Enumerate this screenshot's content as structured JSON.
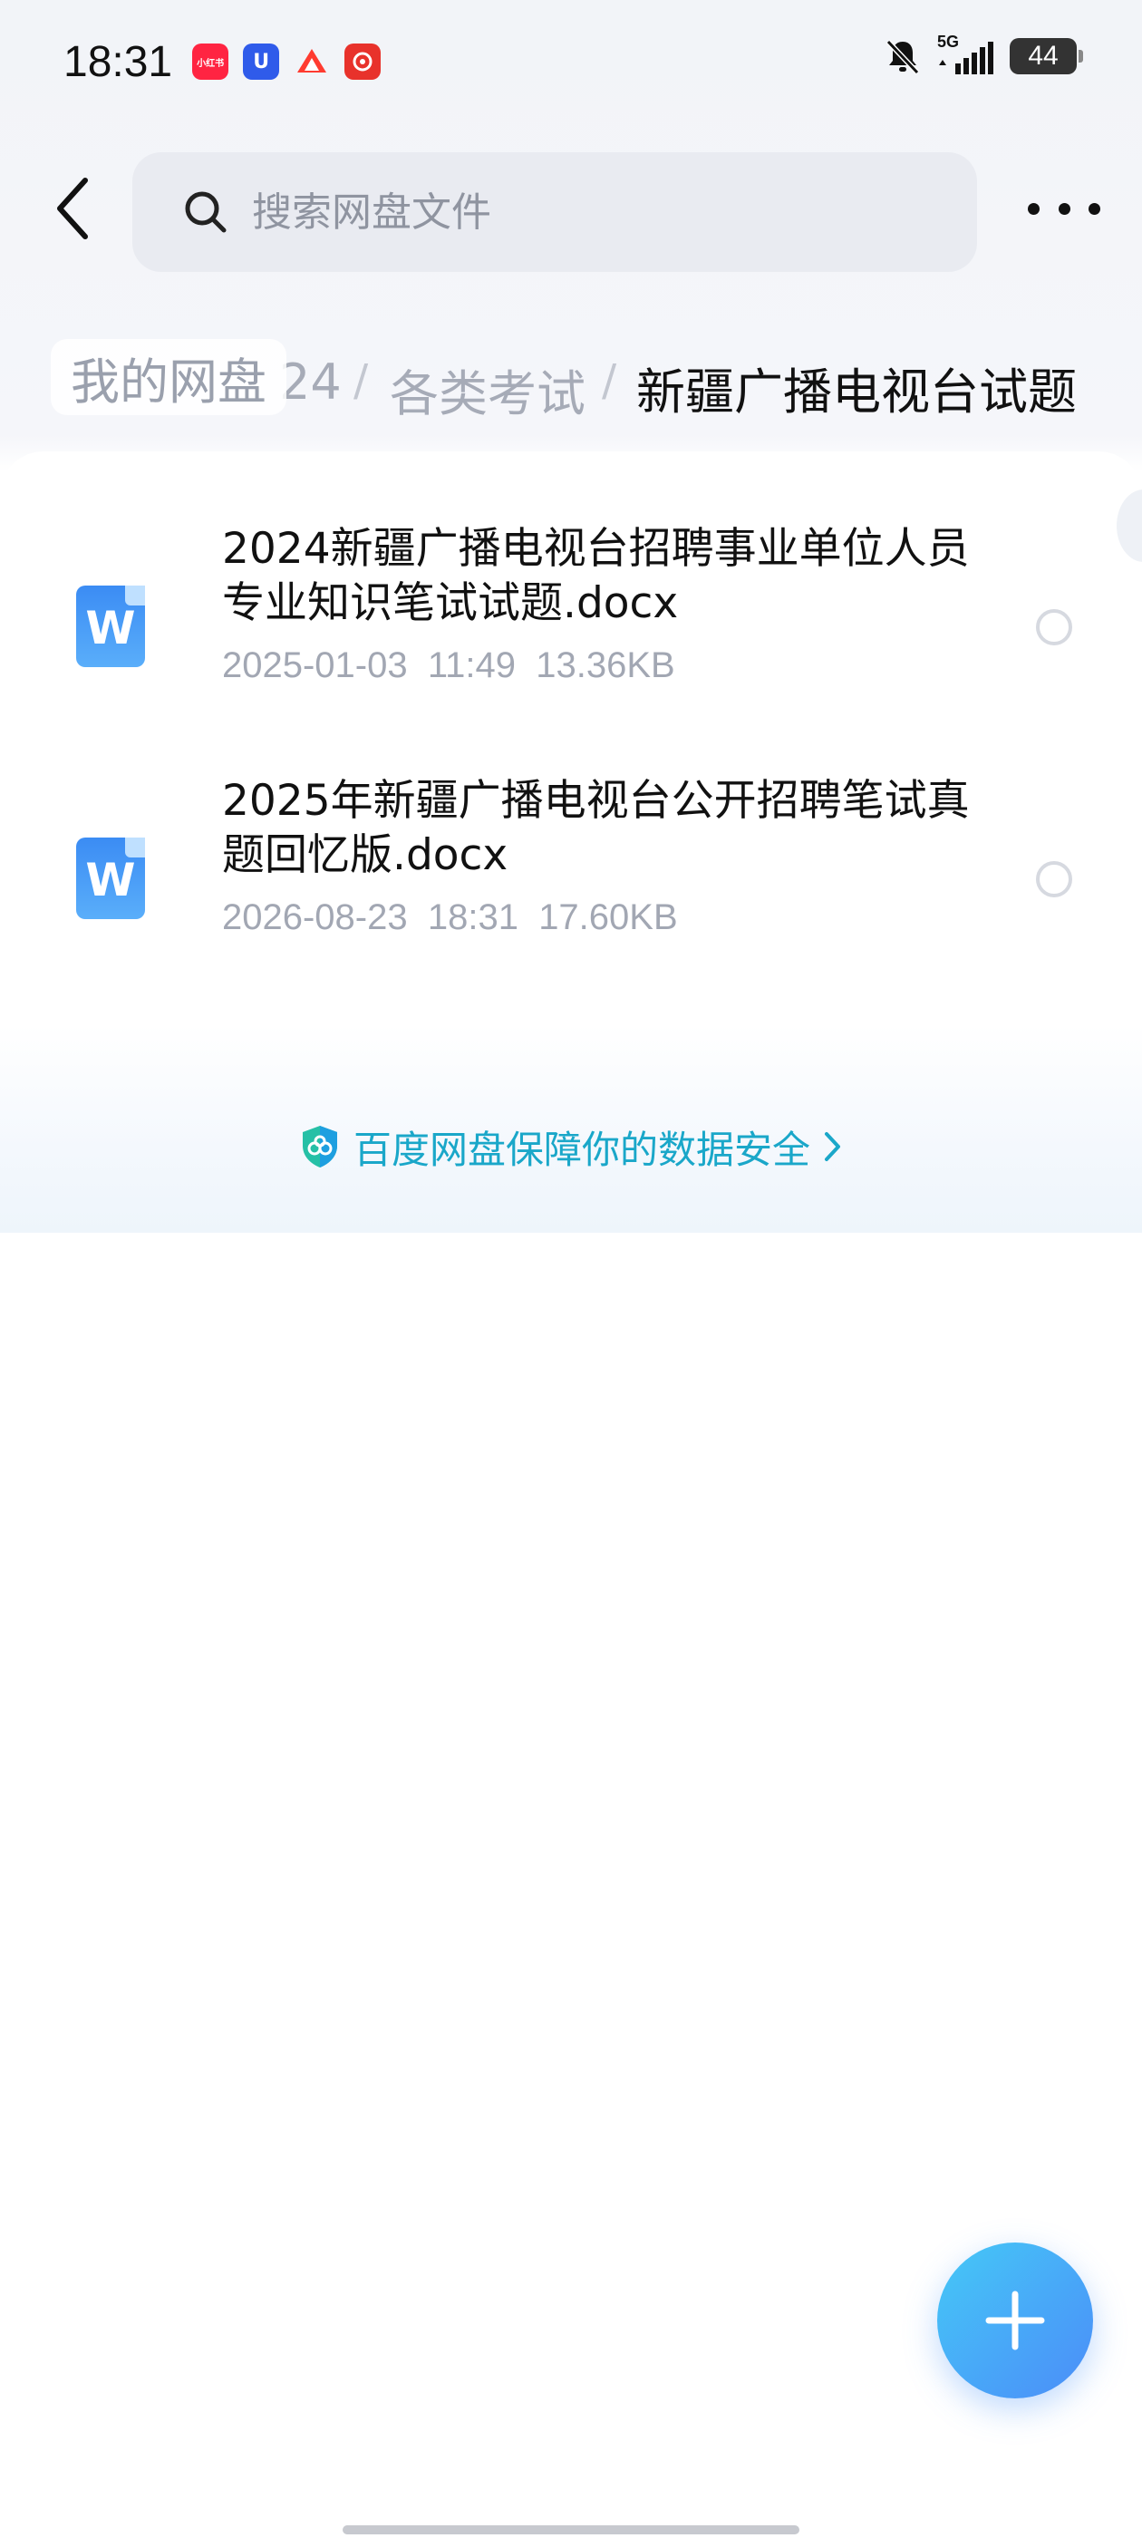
{
  "status_bar": {
    "time": "18:31",
    "network": "5G",
    "battery": "44",
    "notification_apps": [
      {
        "name": "xiaohongshu-app-icon",
        "label": "小红书",
        "color": "#ff2442"
      },
      {
        "name": "u-app-icon",
        "label": "U",
        "color": "#2f5bea"
      },
      {
        "name": "triangle-app-icon",
        "label": "",
        "color": "#ff3b30"
      },
      {
        "name": "red-app-icon",
        "label": "",
        "color": "#e8322b"
      }
    ]
  },
  "header": {
    "search_placeholder": "搜索网盘文件"
  },
  "breadcrumb": {
    "root": "我的网盘",
    "truncated": "24",
    "separator": "/",
    "parent": "各类考试",
    "current": "新疆广播电视台试题"
  },
  "files": [
    {
      "name": "2024新疆广播电视台招聘事业单位人员专业知识笔试试题.docx",
      "date": "2025-01-03",
      "time": "11:49",
      "size": "13.36KB",
      "icon": "word-doc-icon"
    },
    {
      "name": "2025年新疆广播电视台公开招聘笔试真题回忆版.docx",
      "date": "2026-08-23",
      "time": "18:31",
      "size": "17.60KB",
      "icon": "word-doc-icon"
    }
  ],
  "security": {
    "text": "百度网盘保障你的数据安全"
  },
  "colors": {
    "accent": "#1aa7c9",
    "fab_start": "#45c9f7",
    "fab_end": "#4b8cf8",
    "doc_icon": "#3b8cf4"
  }
}
